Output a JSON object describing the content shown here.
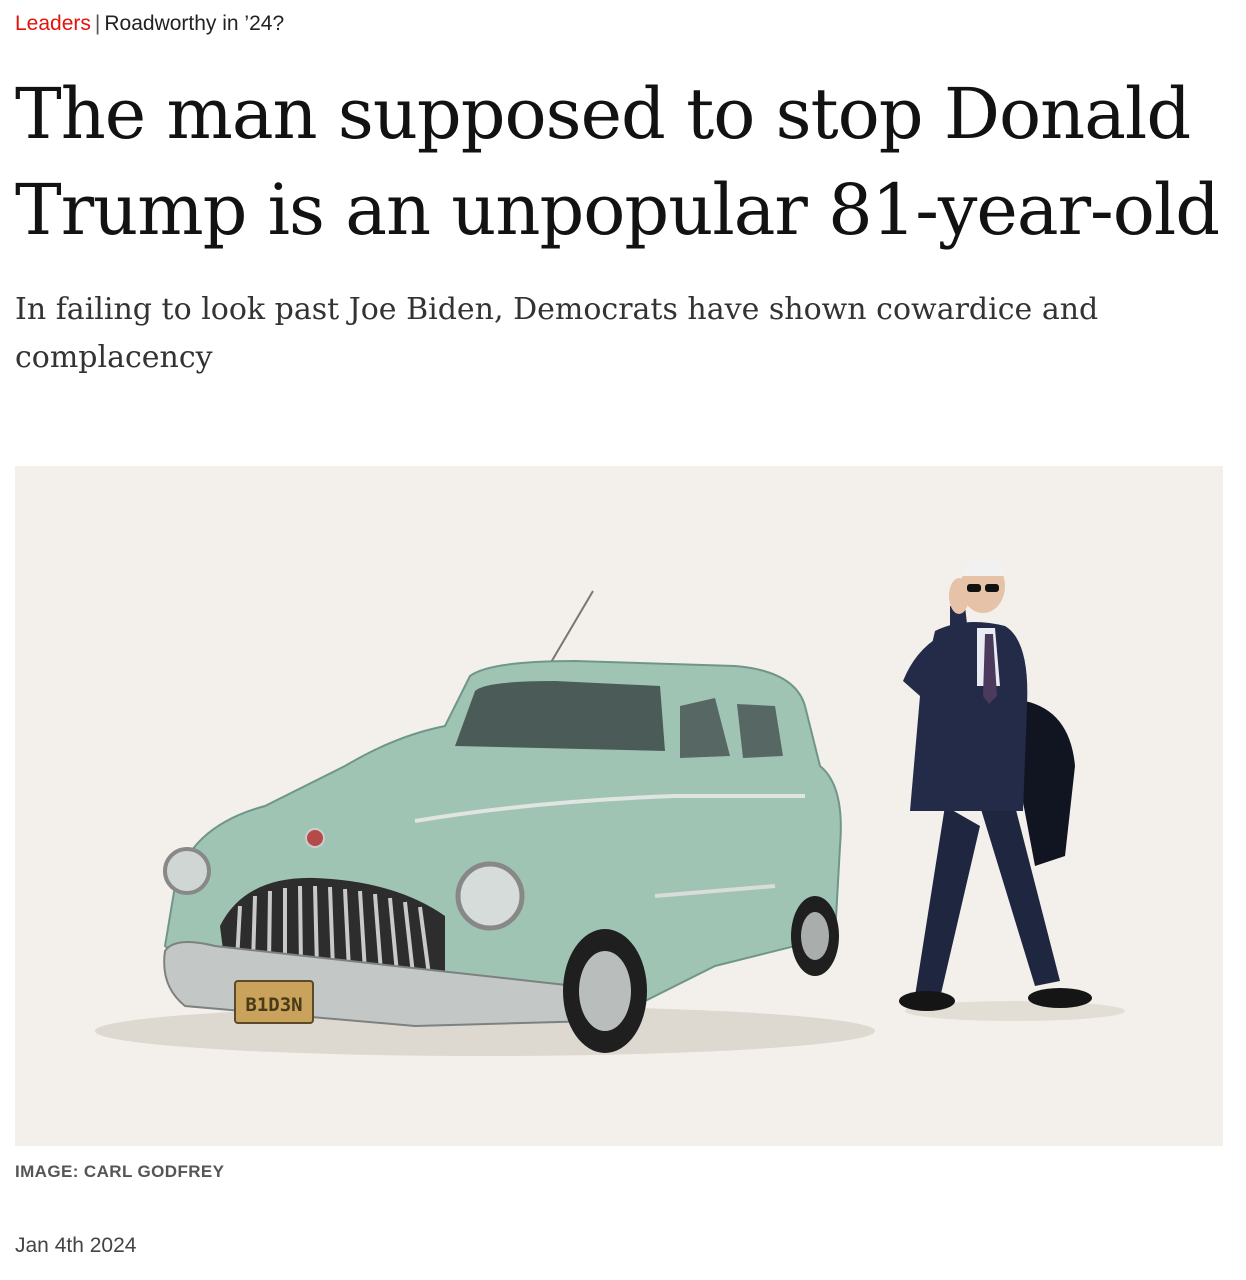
{
  "breadcrumb": {
    "section": "Leaders",
    "separator": "|",
    "flytitle": "Roadworthy in ’24?"
  },
  "headline": "The man supposed to stop Donald Trump is an unpopular 81-year-old",
  "standfirst": "In failing to look past Joe Biden, Democrats have shown cowardice and complacency",
  "image": {
    "plate_text": "B1D3N",
    "background": "#f3f0eb",
    "car_color": "#9fc4b4"
  },
  "credit": "IMAGE: CARL GODFREY",
  "date": "Jan 4th 2024"
}
